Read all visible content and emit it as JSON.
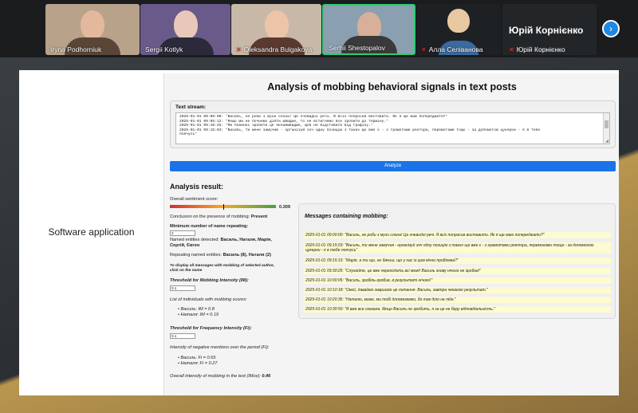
{
  "participants": [
    {
      "name": "Iryna Podhorniuk",
      "muted": false
    },
    {
      "name": "Sergii Kotlyk",
      "muted": false
    },
    {
      "name": "Oleksandra Bulgakova",
      "muted": true
    },
    {
      "name": "Serhii Shestopalov",
      "muted": false
    },
    {
      "name": "Алла Селіванова",
      "muted": true
    }
  ],
  "name_only_tile": {
    "big": "Юрій Корнієнко",
    "small": "Юрій Корнієнко"
  },
  "next_icon": "chevron-right-icon",
  "slide": {
    "left_label": "Software application"
  },
  "app": {
    "title": "Analysis of mobbing behavioral signals in text posts",
    "stream_label": "Text stream:",
    "stream_lines": [
      "2025-01-01 09:00:00: \"Василь, не роби з мухи слона! Це очевидні речі. Я всіх попросив виставити. Як я ще маю попереджати?\"",
      "2025-01-01 09:05:12: \"Якщо ми не почнемо діяти швидше, то не встигнемо все зробити до терміну.\"",
      "2025-01-01 09:10:25: \"Ми повинні зробити це якнайшвидше, щоб не відставати від графіку.\"",
      "2025-01-01 09:15:03: \"Василь, ти мене замучив - організуй хоч одну позицію з таких що вже є - з грамотами ректора, перемогами тощо - за допомогою цукерки - я в тебе",
      "поячусь\""
    ],
    "analyze_label": "Analyze",
    "result_title": "Analysis result:",
    "sentiment_label": "Overall sentiment score:",
    "sentiment_value": "0.309",
    "sentiment_fraction": 0.309,
    "conclusion_prefix": "Conclusion on the presence of mobbing:",
    "conclusion_value": "Present",
    "min_repeat_label": "Minimum number of name repeating:",
    "min_repeat_value": "2",
    "entities_prefix": "Named entities detected:",
    "entities_line1": "Василь, Наталя, Марія,",
    "entities_line2": "Сергій, Євген",
    "repeating_prefix": "Repeating named entities:",
    "repeating_value": "Василь (8), Наталя (2)",
    "hint_line1": "To display all messages with mobbing of selected author,",
    "hint_line2": "click on the name",
    "im_label": "Threshold for Mobbing Intensity (IM):",
    "im_value": "0.1",
    "list_label": "List of individuals with mobbing scores:",
    "im_items": [
      "Василь: IM = 0.8",
      "Наталя: IM = 0.19"
    ],
    "fi_label": "Threshold for Frequency Intensity (Fi):",
    "fi_value": "0.1",
    "fi_desc": "Intensity of negative mentions over the period (Fi):",
    "fi_items": [
      "Василь: Fi = 0.65",
      "Наталя: Fi = 0.27"
    ],
    "overall_prefix": "Overall intensity of mobbing in the text (IMov):",
    "overall_value": "0.46",
    "messages_title": "Messages containing mobbing:",
    "messages": [
      "2025-01-01 09:00:00: \"Василь, не роби з мухи слона! Це очевидні речі. Я всіх попросив виставити. Як я ще маю попереджати?\"",
      "2025-01-01 09:15:03: \"Василь, ти мене замучив - організуй хоч одну позицію з таких що вже є - з грамотами ректора, перемогами тощо - за допомогою цукерки - я в тебе поячусь\"",
      "2025-01-01 09:15:15: \"Марія, а ти що, не бачиш, що у нас із цим вічно проблема?\"",
      "2025-01-01 09:30:25: \"Слухайте, це вже переходить всі межі! Василь знову нічого не зробив!\"",
      "2025-01-01 10:00:05: \"Василь, зробіль-зробив, в результаті нічого!\"",
      "2025-01-01 10:10:18: \"Окей, даваймо закриємо це питання. Василь, завтра чекаємо результат.\"",
      "2025-01-01 10:20:35: \"Наталю, може, ми тобі допоможемо, бо так діло не піде.\"",
      "2025-01-01 10:30:50: \"Я вже все сказала. Якщо Василь не зробить, я за це не беру відповідальність.\""
    ]
  }
}
